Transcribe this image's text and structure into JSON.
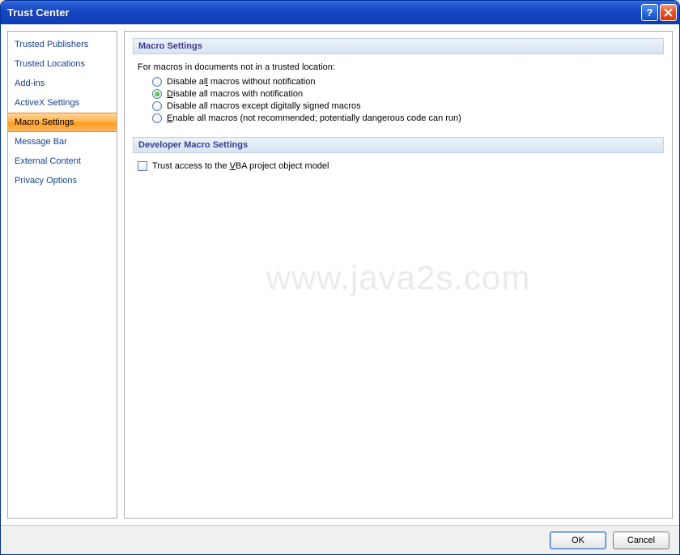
{
  "title": "Trust Center",
  "sidebar": {
    "items": [
      {
        "label": "Trusted Publishers",
        "selected": false
      },
      {
        "label": "Trusted Locations",
        "selected": false
      },
      {
        "label": "Add-ins",
        "selected": false
      },
      {
        "label": "ActiveX Settings",
        "selected": false
      },
      {
        "label": "Macro Settings",
        "selected": true
      },
      {
        "label": "Message Bar",
        "selected": false
      },
      {
        "label": "External Content",
        "selected": false
      },
      {
        "label": "Privacy Options",
        "selected": false
      }
    ]
  },
  "sections": {
    "macro": {
      "header": "Macro Settings",
      "intro": "For macros in documents not in a trusted location:",
      "options": [
        {
          "pre": "Disable al",
          "u": "l",
          "post": " macros without notification",
          "checked": false
        },
        {
          "pre": "",
          "u": "D",
          "post": "isable all macros with notification",
          "checked": true
        },
        {
          "pre": "Disable all macros except di",
          "u": "g",
          "post": "itally signed macros",
          "checked": false
        },
        {
          "pre": "",
          "u": "E",
          "post": "nable all macros (not recommended; potentially dangerous code can run)",
          "checked": false
        }
      ]
    },
    "developer": {
      "header": "Developer Macro Settings",
      "check": {
        "pre": "Trust access to the ",
        "u": "V",
        "post": "BA project object model",
        "checked": false
      }
    }
  },
  "footer": {
    "ok": "OK",
    "cancel": "Cancel"
  },
  "watermark": "www.java2s.com"
}
